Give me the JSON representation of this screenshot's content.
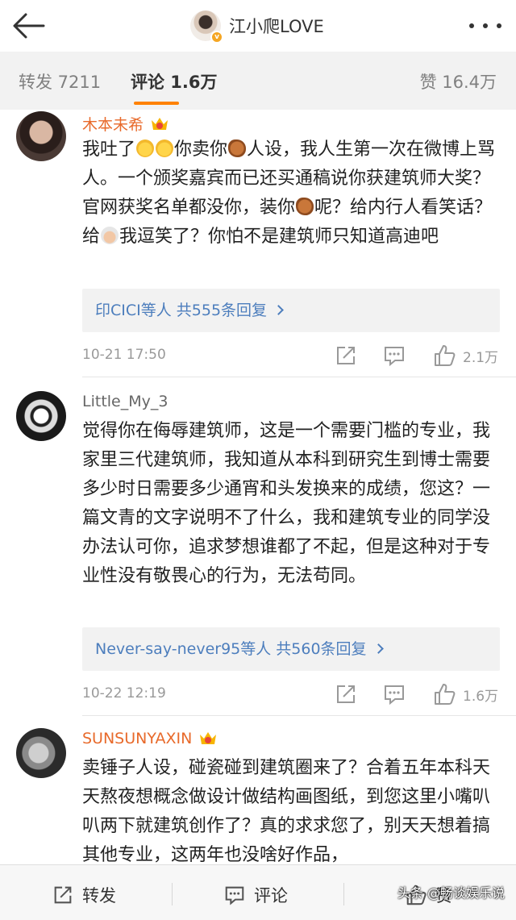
{
  "header": {
    "title": "江小爬LOVE",
    "back_icon": "back-arrow-icon",
    "more_icon": "more-dots-icon"
  },
  "tabs": {
    "repost": "转发 7211",
    "comment": "评论 1.6万",
    "like": "赞 16.4万"
  },
  "comments": [
    {
      "user": "木本未希",
      "text_parts": [
        "我吐了",
        "你卖你",
        "人设，我人生第一次在微博上骂人。一个颁奖嘉宾而已还买通稿说你获建筑师大奖？官网获奖名单都没你，装你",
        "呢？给内行人看笑话？给",
        "我逗笑了？你怕不是建筑师只知道高迪吧"
      ],
      "replies": "印CICI等人  共555条回复",
      "time": "10-21 17:50",
      "likes": "2.1万"
    },
    {
      "user": "Little_My_3",
      "text": "觉得你在侮辱建筑师，这是一个需要门槛的专业，我家里三代建筑师，我知道从本科到研究生到博士需要多少时日需要多少通宵和头发换来的成绩，您这？一篇文青的文字说明不了什么，我和建筑专业的同学没办法认可你，追求梦想谁都了不起，但是这种对于专业性没有敬畏心的行为，无法苟同。",
      "replies": "Never-say-never95等人  共560条回复",
      "time": "10-22 12:19",
      "likes": "1.6万"
    },
    {
      "user": "SUNSUNYAXIN",
      "text": "卖锤子人设，碰瓷碰到建筑圈来了？合着五年本科天天熬夜想概念做设计做结构画图纸，到您这里小嘴叭叭两下就建筑创作了？真的求求您了，别天天想着搞其他专业，这两年也没啥好作品，"
    }
  ],
  "bottom_bar": {
    "repost": "转发",
    "comment": "评论",
    "like": "赞"
  },
  "watermark": "头条 @畅谈娱乐说",
  "colors": {
    "accent": "#ff8200",
    "username_orange": "#e86a2b",
    "link_blue": "#4d7ebd",
    "tab_bg": "#f2f2f2"
  }
}
